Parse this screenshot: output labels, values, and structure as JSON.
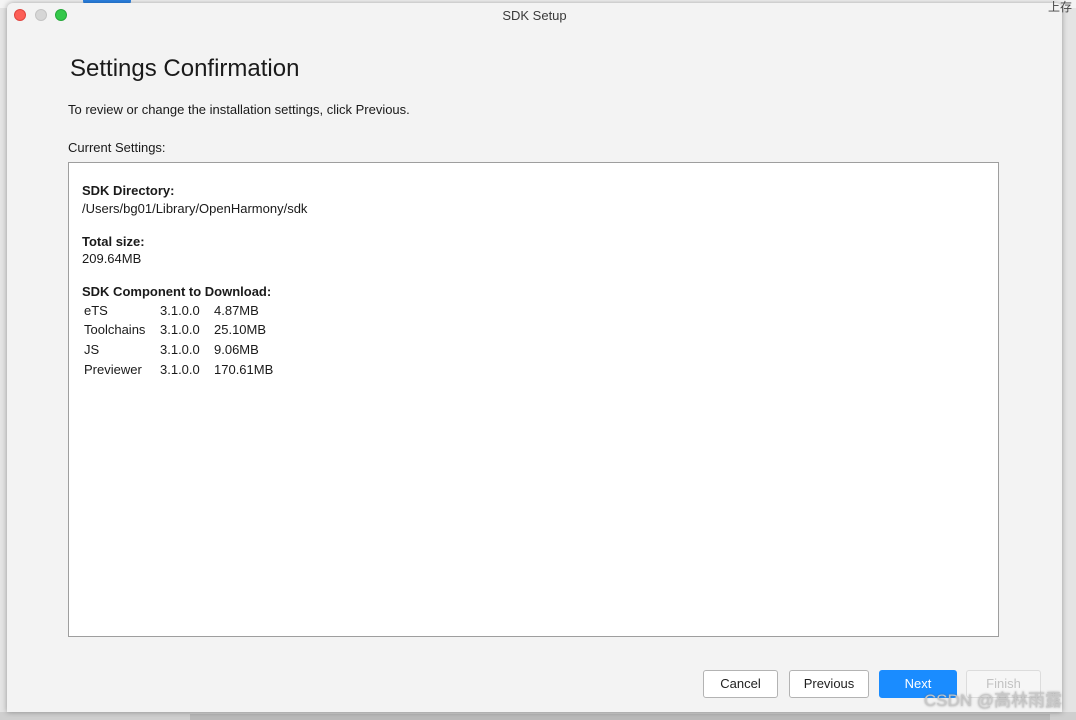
{
  "background": {
    "fragment": "上存"
  },
  "window": {
    "title": "SDK Setup"
  },
  "page": {
    "heading": "Settings Confirmation",
    "instruction": "To review or change the installation settings, click Previous.",
    "current_settings_label": "Current Settings:"
  },
  "settings": {
    "sdk_directory_label": "SDK Directory:",
    "sdk_directory_value": "/Users/bg01/Library/OpenHarmony/sdk",
    "total_size_label": "Total size:",
    "total_size_value": "209.64MB",
    "components_label": "SDK Component to Download:",
    "components": [
      {
        "name": "eTS",
        "version": "3.1.0.0",
        "size": "4.87MB"
      },
      {
        "name": "Toolchains",
        "version": "3.1.0.0",
        "size": "25.10MB"
      },
      {
        "name": "JS",
        "version": "3.1.0.0",
        "size": "9.06MB"
      },
      {
        "name": "Previewer",
        "version": "3.1.0.0",
        "size": "170.61MB"
      }
    ]
  },
  "buttons": {
    "cancel": "Cancel",
    "previous": "Previous",
    "next": "Next",
    "finish": "Finish",
    "finish_enabled": false,
    "default_button": "next"
  },
  "watermark": "CSDN @高林雨露",
  "colors": {
    "accent": "#1a8cff",
    "close": "#fc5f57",
    "minimize_inactive": "#d6d6d6",
    "zoom": "#34c84a",
    "window_bg": "#f3f3f3"
  },
  "icons": {
    "close": "close-icon",
    "minimize": "minimize-icon",
    "zoom": "zoom-icon"
  }
}
